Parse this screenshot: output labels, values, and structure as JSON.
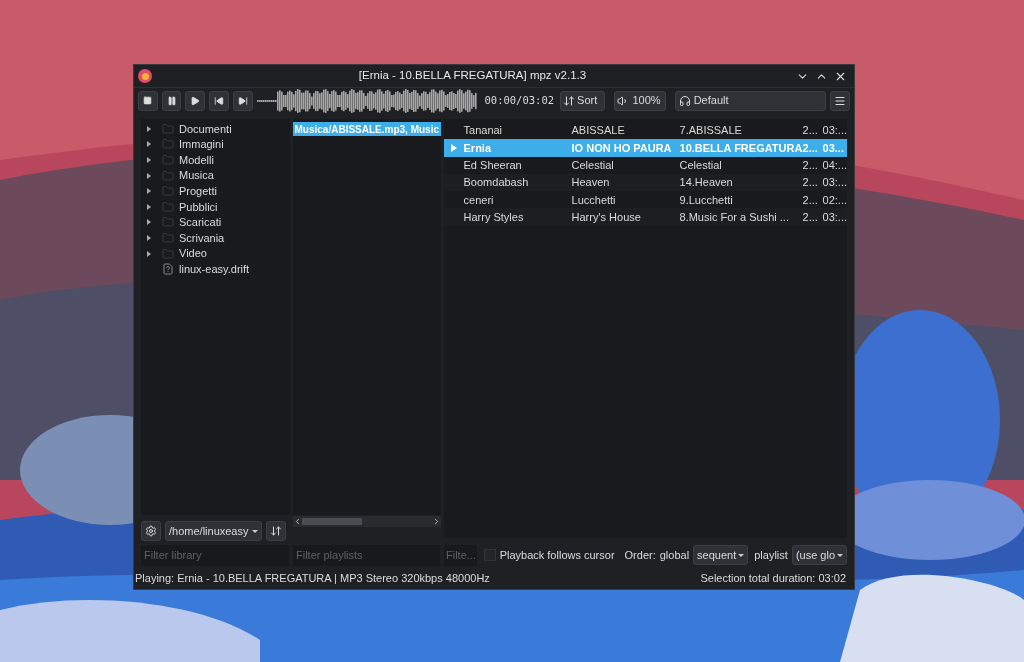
{
  "window": {
    "title": "[Ernia - 10.BELLA FREGATURA] mpz v2.1.3"
  },
  "toolbar": {
    "time": "00:00/03:02",
    "sort_label": "Sort",
    "volume": "100%",
    "output": "Default"
  },
  "library": {
    "items": [
      {
        "label": "Documenti",
        "kind": "folder",
        "expanded": false
      },
      {
        "label": "Immagini",
        "kind": "folder",
        "expanded": false
      },
      {
        "label": "Modelli",
        "kind": "folder",
        "expanded": false
      },
      {
        "label": "Musica",
        "kind": "folder",
        "expanded": false
      },
      {
        "label": "Progetti",
        "kind": "folder",
        "expanded": false
      },
      {
        "label": "Pubblici",
        "kind": "folder",
        "expanded": false
      },
      {
        "label": "Scaricati",
        "kind": "folder",
        "expanded": false
      },
      {
        "label": "Scrivania",
        "kind": "folder",
        "expanded": false
      },
      {
        "label": "Video",
        "kind": "folder",
        "expanded": false
      },
      {
        "label": "linux-easy.drift",
        "kind": "file"
      }
    ],
    "path": "/home/linuxeasy",
    "filter_placeholder": "Filter library"
  },
  "playlists": {
    "items": [
      {
        "label": "Musica/ABISSALE.mp3, Music",
        "selected": true
      }
    ],
    "filter_placeholder": "Filter playlists"
  },
  "tracks": {
    "rows": [
      {
        "artist": "Tananai",
        "album": "ABISSALE",
        "title": "7.ABISSALE",
        "column_4": "2...",
        "column_5": "03:...",
        "selected": false,
        "playing": false
      },
      {
        "artist": "Ernia",
        "album": "IO NON HO PAURA",
        "title": "10.BELLA FREGATURA",
        "column_4": "2...",
        "column_5": "03...",
        "selected": true,
        "playing": true
      },
      {
        "artist": "Ed Sheeran",
        "album": "Celestial",
        "title": "Celestial",
        "column_4": "2...",
        "column_5": "04:...",
        "selected": false,
        "playing": false
      },
      {
        "artist": "Boomdabash",
        "album": "Heaven",
        "title": "14.Heaven",
        "column_4": "2...",
        "column_5": "03:...",
        "selected": false,
        "playing": false
      },
      {
        "artist": "ceneri",
        "album": "Lucchetti",
        "title": "9.Lucchetti",
        "column_4": "2...",
        "column_5": "02:...",
        "selected": false,
        "playing": false
      },
      {
        "artist": "Harry Styles",
        "album": "Harry's House",
        "title": "8.Music For a Sushi ...",
        "column_4": "2...",
        "column_5": "03:...",
        "selected": false,
        "playing": false
      }
    ],
    "filter_placeholder": "Filte...",
    "follow_cursor": {
      "label": "Playback follows cursor",
      "checked": false
    },
    "order_label": "Order:",
    "global_label": "global",
    "global_value": "sequent",
    "playlist_label": "playlist",
    "playlist_value": "(use glo"
  },
  "status_bar": {
    "playing": "Playing: Ernia - 10.BELLA FREGATURA | MP3 Stereo 320kbps 48000Hz",
    "selection": "Selection total duration: 03:02"
  }
}
